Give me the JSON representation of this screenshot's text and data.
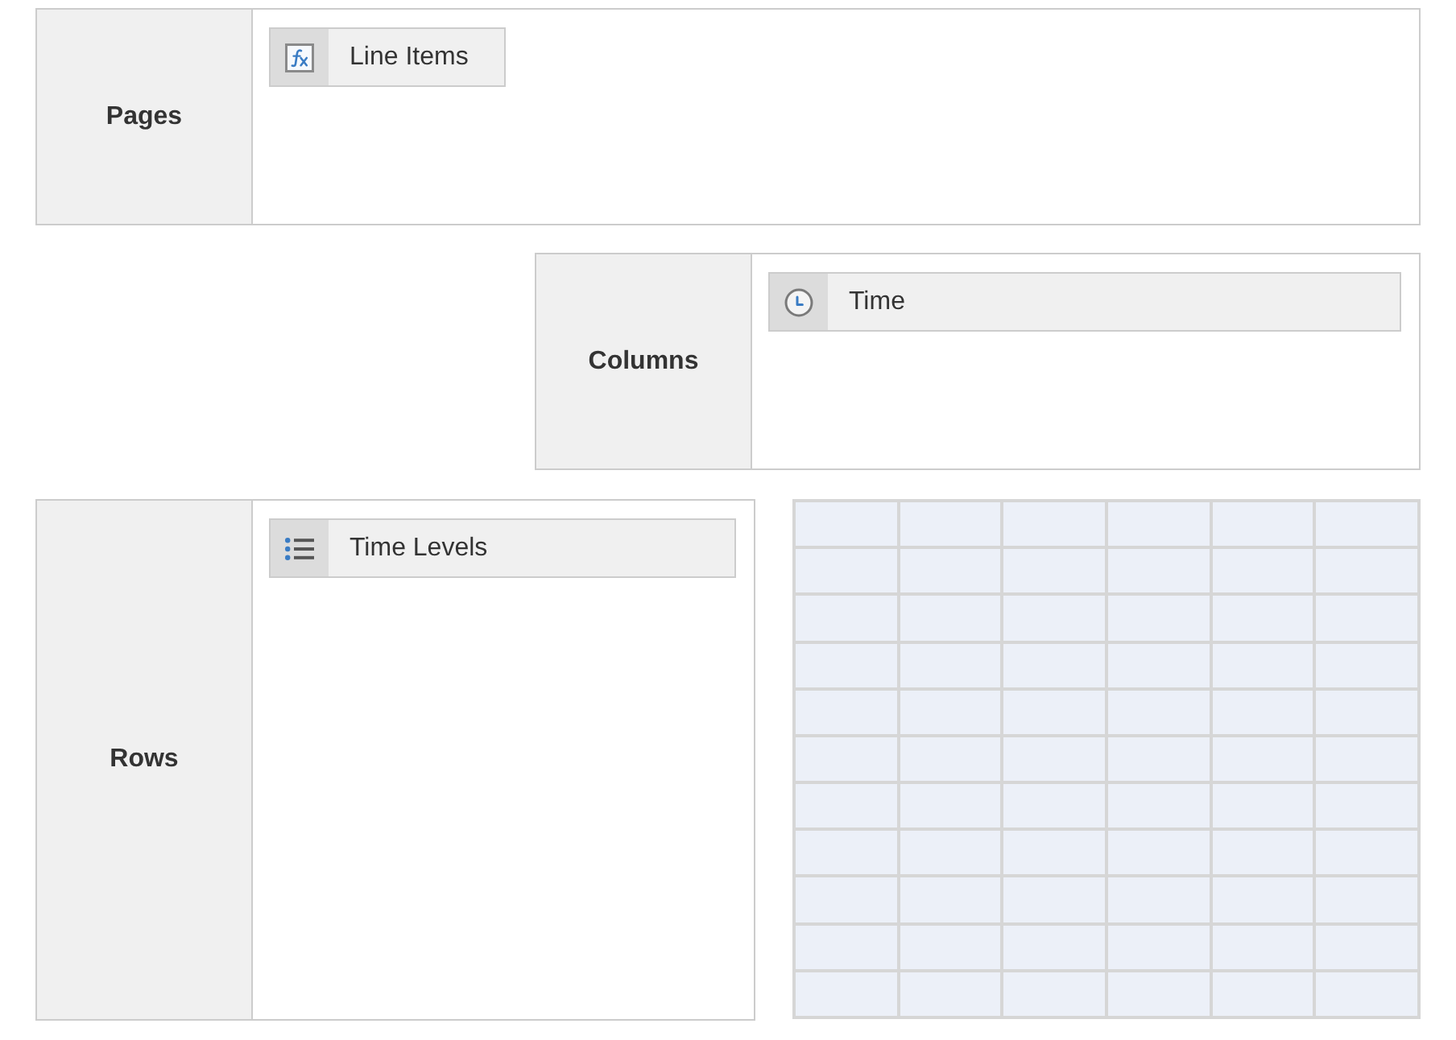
{
  "pages": {
    "label": "Pages",
    "items": [
      {
        "kind": "line_items",
        "label": "Line Items"
      }
    ]
  },
  "columns": {
    "label": "Columns",
    "items": [
      {
        "kind": "time",
        "label": "Time"
      }
    ]
  },
  "rows": {
    "label": "Rows",
    "items": [
      {
        "kind": "list",
        "label": "Time Levels"
      }
    ]
  }
}
